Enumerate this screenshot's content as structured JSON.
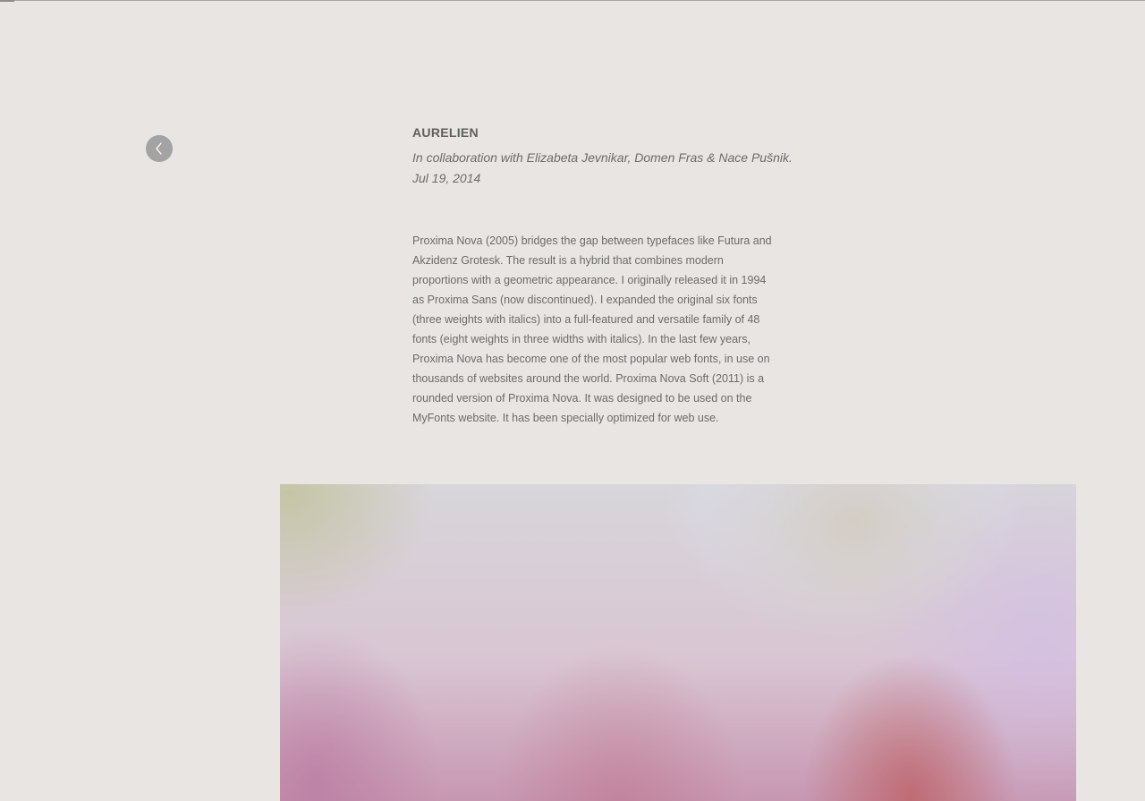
{
  "navigation": {
    "back_icon": "chevron-left-icon"
  },
  "article": {
    "title": "AURELIEN",
    "credit": "In collaboration with Elizabeta Jevnikar, Domen Fras & Nace Pušnik.",
    "date": "Jul 19, 2014",
    "body": "Proxima Nova (2005) bridges the gap between typefaces like Futura and Akzidenz Grotesk. The result is a hybrid that combines modern proportions with a geometric appearance. I originally released it in 1994 as Proxima Sans (now discontinued). I expanded the original six fonts (three weights with italics) into a full-featured and versatile family of 48 fonts (eight weights in three widths with italics). In the last few years, Proxima Nova has become one of the most popular web fonts, in use on thousands of websites around the world. Proxima Nova Soft (2011) is a rounded version of Proxima Nova. It was designed to be used on the MyFonts website. It has been specially optimized for web use."
  },
  "colors": {
    "background": "#e8e5e2",
    "text": "#6c6c6c",
    "button": "#a3a3a3"
  }
}
